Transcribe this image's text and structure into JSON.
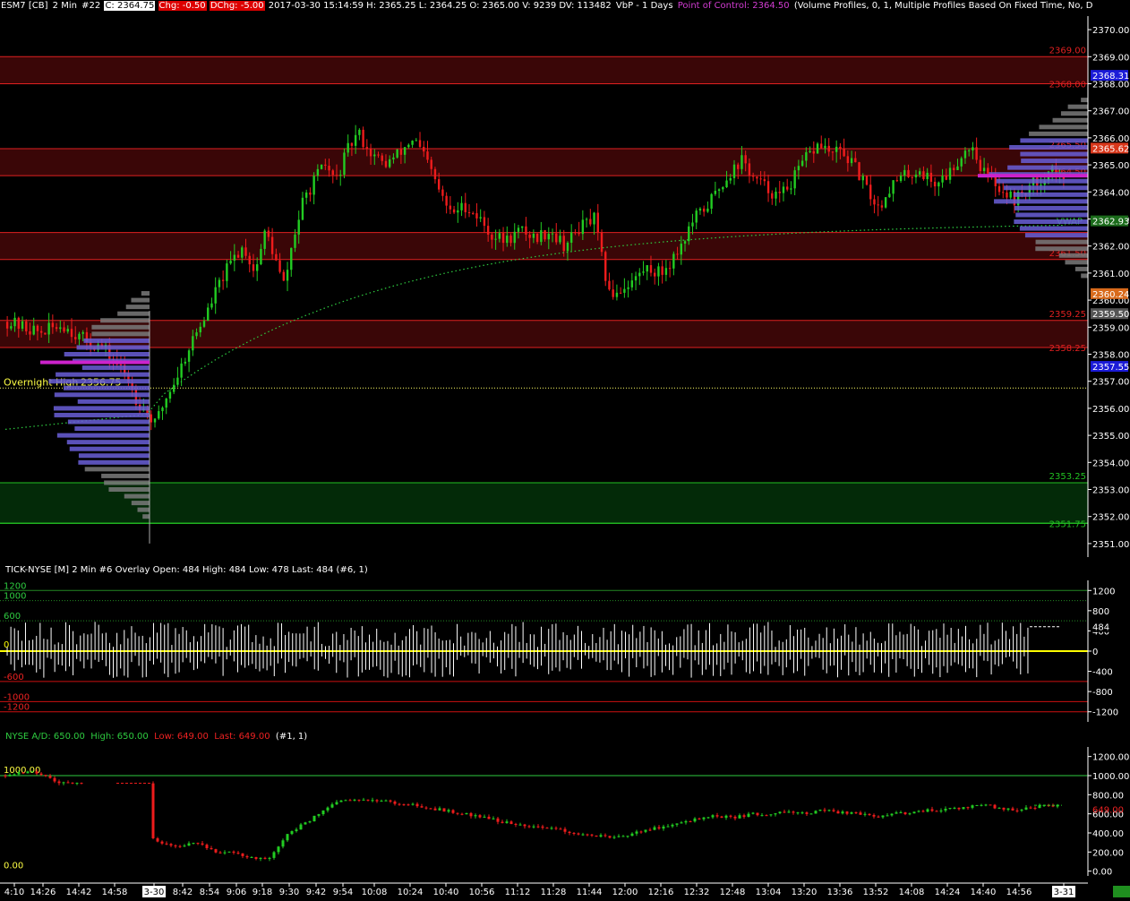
{
  "header": {
    "symbol": "ESM7 [CB]",
    "interval": "2 Min",
    "chart_no": "#22",
    "close_label": "C: 2364.75",
    "chg_label": "Chg: -0.50",
    "dchg_label": "DChg: -5.00",
    "stats": "2017-03-30 15:14:59 H: 2365.25 L: 2364.25 O: 2365.00 V: 9239 DV: 113482",
    "vbp": "VbP - 1 Days",
    "poc_label": "Point of Control: 2364.50",
    "profile_desc": "(Volume Profiles, 0, 1, Multiple Profiles Based On Fixed Time, No, D"
  },
  "tick_header": "TICK-NYSE [M]  2 Min   #6 Overlay  Open: 484  High: 484  Low: 478  Last: 484   (#6, 1)",
  "ad_header": {
    "name": "NYSE A/D: 650.00",
    "high": "High: 650.00",
    "low": "Low: 649.00",
    "last": "Last: 649.00",
    "tail": "(#1, 1)"
  },
  "colors": {
    "up": "#22cc22",
    "down": "#ee1c1c",
    "resistance_fill": "#3a0607",
    "resistance_line": "#e02020",
    "support_fill": "#032a08",
    "support_line": "#22c022",
    "vwap": "#2ecc40",
    "profile_blue": "#6a5fd8",
    "profile_gray": "#7a7a7a",
    "poc": "#cc22cc",
    "zero_line": "#ffff00"
  },
  "chart_data": [
    {
      "type": "candlestick",
      "title": "ESM7 [CB] 2 Min",
      "ylim": [
        2350.5,
        2370.5
      ],
      "y_ticks": [
        2351,
        2352,
        2353,
        2354,
        2355,
        2356,
        2357,
        2358,
        2359,
        2360,
        2361,
        2362,
        2363,
        2364,
        2365,
        2366,
        2367,
        2368,
        2369,
        2370
      ],
      "zones": [
        {
          "kind": "resistance",
          "low": 2368.0,
          "high": 2369.0,
          "label": "2369.00"
        },
        {
          "kind": "resistance",
          "low": 2368.0,
          "high": 2368.0,
          "label": "2368.00"
        },
        {
          "kind": "resistance",
          "low": 2364.6,
          "high": 2365.6,
          "label": "2365.50"
        },
        {
          "kind": "resistance",
          "low": 2361.5,
          "high": 2362.5,
          "label": "2361.50"
        },
        {
          "kind": "resistance",
          "low": 2358.25,
          "high": 2359.25,
          "label": "2359.25"
        },
        {
          "kind": "resistance",
          "low": 2358.25,
          "high": 2358.25,
          "label": "2358.25"
        },
        {
          "kind": "support",
          "low": 2351.75,
          "high": 2353.25,
          "label": "2353.25"
        },
        {
          "kind": "support",
          "low": 2351.75,
          "high": 2351.75,
          "label": "2351.75"
        }
      ],
      "zone_labels": [
        "2369.00",
        "2368.00",
        "2365.50",
        "2364.50",
        "2361.50",
        "2359.25",
        "2358.25",
        "2353.25",
        "2351.75"
      ],
      "overnight_high": {
        "label": "Overnight High",
        "value_label": "2356.75",
        "value": 2356.75
      },
      "vwap": {
        "label": "VWAP",
        "value": 2362.93
      },
      "price_markers": [
        {
          "label": "2368.31",
          "value": 2368.31,
          "color": "#1b1bd8"
        },
        {
          "label": "2365.62",
          "value": 2365.62,
          "color": "#d8371b"
        },
        {
          "label": "2362.93",
          "value": 2362.93,
          "color": "#1b6b1b"
        },
        {
          "label": "2360.24",
          "value": 2360.24,
          "color": "#d86a1b"
        },
        {
          "label": "2359.50",
          "value": 2359.5,
          "color": "#555555"
        },
        {
          "label": "2357.55",
          "value": 2357.55,
          "color": "#1b1bd8"
        }
      ],
      "x_ticks": [
        "4:10",
        "14:26",
        "14:42",
        "14:58",
        "3-30",
        "8:42",
        "8:54",
        "9:06",
        "9:18",
        "9:30",
        "9:42",
        "9:54",
        "10:08",
        "10:24",
        "10:40",
        "10:56",
        "11:12",
        "11:28",
        "11:44",
        "12:00",
        "12:16",
        "12:32",
        "12:48",
        "13:04",
        "13:20",
        "13:36",
        "13:52",
        "14:08",
        "14:24",
        "14:40",
        "14:56",
        "3-31"
      ],
      "price_path": [
        [
          0,
          2359.2
        ],
        [
          18,
          2358.8
        ],
        [
          30,
          2359.1
        ],
        [
          40,
          2358.6
        ],
        [
          52,
          2358.2
        ],
        [
          60,
          2357.6
        ],
        [
          66,
          2357.0
        ],
        [
          70,
          2356.3
        ],
        [
          74,
          2356.0
        ],
        [
          80,
          2355.4
        ],
        [
          86,
          2356.4
        ],
        [
          92,
          2357.2
        ],
        [
          100,
          2358.5
        ],
        [
          108,
          2359.5
        ],
        [
          114,
          2360.5
        ],
        [
          122,
          2361.5
        ],
        [
          128,
          2362.0
        ],
        [
          134,
          2361.0
        ],
        [
          140,
          2362.6
        ],
        [
          146,
          2361.3
        ],
        [
          150,
          2360.5
        ],
        [
          154,
          2362.0
        ],
        [
          160,
          2363.6
        ],
        [
          166,
          2364.4
        ],
        [
          172,
          2365.0
        ],
        [
          178,
          2364.4
        ],
        [
          184,
          2365.5
        ],
        [
          190,
          2366.2
        ],
        [
          196,
          2365.5
        ],
        [
          204,
          2365.0
        ],
        [
          212,
          2365.4
        ],
        [
          220,
          2366.0
        ],
        [
          228,
          2365.0
        ],
        [
          234,
          2364.0
        ],
        [
          240,
          2363.2
        ],
        [
          248,
          2363.5
        ],
        [
          256,
          2363.0
        ],
        [
          262,
          2362.4
        ],
        [
          270,
          2362.2
        ],
        [
          278,
          2362.6
        ],
        [
          286,
          2362.3
        ],
        [
          294,
          2362.6
        ],
        [
          302,
          2362.0
        ],
        [
          310,
          2362.7
        ],
        [
          318,
          2363.0
        ],
        [
          322,
          2361.5
        ],
        [
          326,
          2360.2
        ],
        [
          332,
          2360.4
        ],
        [
          340,
          2360.8
        ],
        [
          346,
          2361.2
        ],
        [
          354,
          2361.0
        ],
        [
          360,
          2361.5
        ],
        [
          366,
          2362.2
        ],
        [
          372,
          2363.0
        ],
        [
          378,
          2363.4
        ],
        [
          384,
          2364.0
        ],
        [
          390,
          2364.6
        ],
        [
          398,
          2365.2
        ],
        [
          404,
          2364.5
        ],
        [
          410,
          2364.2
        ],
        [
          418,
          2363.8
        ],
        [
          426,
          2364.5
        ],
        [
          432,
          2365.2
        ],
        [
          440,
          2365.8
        ],
        [
          446,
          2365.4
        ],
        [
          452,
          2365.5
        ],
        [
          460,
          2364.8
        ],
        [
          466,
          2364.0
        ],
        [
          472,
          2363.4
        ],
        [
          478,
          2364.2
        ],
        [
          486,
          2364.6
        ],
        [
          494,
          2364.8
        ],
        [
          502,
          2364.3
        ],
        [
          510,
          2364.7
        ],
        [
          516,
          2365.3
        ],
        [
          522,
          2365.8
        ],
        [
          528,
          2364.8
        ],
        [
          534,
          2364.4
        ],
        [
          540,
          2364.0
        ],
        [
          546,
          2363.7
        ],
        [
          552,
          2364.1
        ],
        [
          560,
          2364.5
        ],
        [
          566,
          2364.9
        ],
        [
          572,
          2364.3
        ]
      ]
    },
    {
      "type": "bar",
      "title": "TICK-NYSE [M] 2 Min",
      "ylim": [
        -1400,
        1400
      ],
      "y_ticks": [
        1200,
        800,
        400,
        0,
        -400,
        -800,
        -1200
      ],
      "levels": [
        {
          "value": 1200,
          "label": "1200",
          "color": "#228822"
        },
        {
          "value": 1000,
          "label": "1000",
          "color": "#228822"
        },
        {
          "value": 600,
          "label": "600",
          "color": "#228822"
        },
        {
          "value": 0,
          "label": "0",
          "color": "#ffff00"
        },
        {
          "value": -600,
          "label": "-600",
          "color": "#cc1111"
        },
        {
          "value": -1000,
          "label": "-1000",
          "color": "#cc1111"
        },
        {
          "value": -1200,
          "label": "-1200",
          "color": "#cc1111"
        }
      ],
      "last": {
        "value": 484,
        "label": "484"
      }
    },
    {
      "type": "candlestick",
      "title": "NYSE A/D",
      "ylim": [
        -50,
        1300
      ],
      "y_ticks": [
        1200,
        1000,
        800,
        600,
        400,
        200,
        0
      ],
      "y_tick_labels": [
        "1200.00",
        "1000.00",
        "800.00",
        "600.00",
        "400.00",
        "200.00",
        "0.00"
      ],
      "levels": [
        {
          "value": 1000,
          "label": "1000.00"
        },
        {
          "value": 0,
          "label": "0.00"
        }
      ],
      "last": {
        "value": 649,
        "label": "649.00"
      },
      "path": [
        [
          0,
          1000
        ],
        [
          30,
          1040
        ],
        [
          50,
          1010
        ],
        [
          60,
          950
        ],
        [
          70,
          920
        ],
        [
          90,
          930
        ],
        [
          168,
          350
        ],
        [
          180,
          290
        ],
        [
          200,
          260
        ],
        [
          220,
          300
        ],
        [
          240,
          210
        ],
        [
          260,
          190
        ],
        [
          280,
          150
        ],
        [
          300,
          120
        ],
        [
          310,
          230
        ],
        [
          320,
          370
        ],
        [
          340,
          500
        ],
        [
          360,
          620
        ],
        [
          370,
          700
        ],
        [
          380,
          730
        ],
        [
          400,
          760
        ],
        [
          420,
          740
        ],
        [
          440,
          720
        ],
        [
          460,
          690
        ],
        [
          480,
          660
        ],
        [
          500,
          630
        ],
        [
          520,
          600
        ],
        [
          540,
          560
        ],
        [
          560,
          520
        ],
        [
          580,
          490
        ],
        [
          600,
          460
        ],
        [
          620,
          440
        ],
        [
          640,
          400
        ],
        [
          660,
          370
        ],
        [
          680,
          360
        ],
        [
          700,
          380
        ],
        [
          720,
          420
        ],
        [
          740,
          470
        ],
        [
          760,
          510
        ],
        [
          780,
          550
        ],
        [
          800,
          580
        ],
        [
          820,
          560
        ],
        [
          840,
          600
        ],
        [
          860,
          590
        ],
        [
          880,
          620
        ],
        [
          900,
          600
        ],
        [
          920,
          640
        ],
        [
          940,
          610
        ],
        [
          960,
          600
        ],
        [
          980,
          560
        ],
        [
          1000,
          600
        ],
        [
          1020,
          620
        ],
        [
          1040,
          640
        ],
        [
          1060,
          650
        ],
        [
          1080,
          670
        ],
        [
          1100,
          700
        ],
        [
          1120,
          640
        ],
        [
          1140,
          650
        ],
        [
          1160,
          680
        ],
        [
          1180,
          690
        ]
      ]
    }
  ]
}
